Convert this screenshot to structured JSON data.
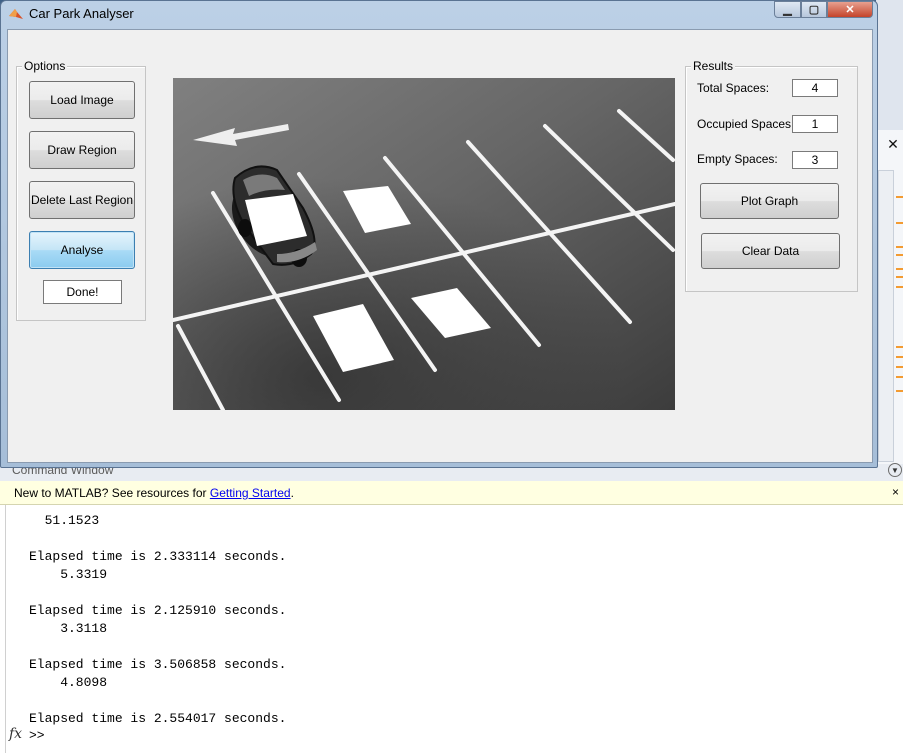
{
  "window": {
    "title": "Car Park Analyser",
    "icon": "matlab-icon",
    "min_icon": "minimize-icon",
    "max_icon": "maximize-icon",
    "close_icon": "close-icon"
  },
  "options": {
    "label": "Options",
    "load_image": "Load Image",
    "draw_region": "Draw Region",
    "delete_last_region": "Delete Last Region",
    "analyse": "Analyse",
    "done": "Done!"
  },
  "results": {
    "label": "Results",
    "total_label": "Total Spaces:",
    "total_value": "4",
    "occupied_label": "Occupied Spaces:",
    "occupied_value": "1",
    "empty_label": "Empty Spaces:",
    "empty_value": "3",
    "plot_graph": "Plot Graph",
    "clear_data": "Clear Data"
  },
  "command_window": {
    "title": "Command Window",
    "banner_prefix": "New to MATLAB? See resources for ",
    "banner_link": "Getting Started",
    "banner_suffix": ".",
    "banner_close": "×",
    "output": "  51.1523\n\nElapsed time is 2.333114 seconds.\n    5.3319\n\nElapsed time is 2.125910 seconds.\n    3.3118\n\nElapsed time is 3.506858 seconds.\n    4.8098\n\nElapsed time is 2.554017 seconds.",
    "fx": "fx",
    "prompt": ">>"
  },
  "colors": {
    "accent_button": "#a9dbf6",
    "link": "#0000ee",
    "banner_bg": "#ffffe1"
  }
}
